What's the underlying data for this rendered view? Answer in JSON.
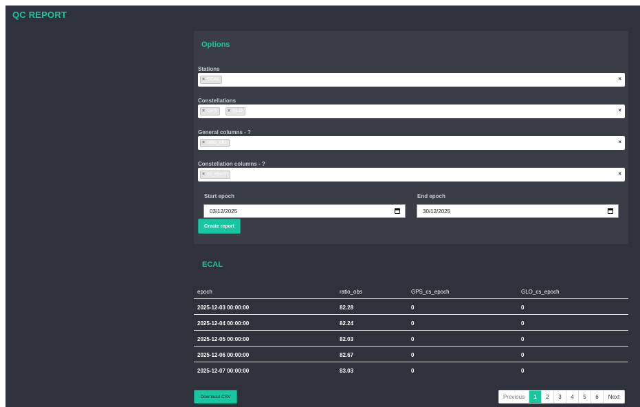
{
  "app": {
    "brand": "QC REPORT"
  },
  "options": {
    "title": "Options",
    "stations": {
      "label": "Stations",
      "tags": [
        "ECAL"
      ],
      "clear": "×"
    },
    "constellations": {
      "label": "Constellations",
      "tags": [
        "GPS",
        "GLO"
      ],
      "clear": "×"
    },
    "general_columns": {
      "label": "General columns - ?",
      "tags": [
        "ratio_obs"
      ],
      "clear": "×"
    },
    "constellation_columns": {
      "label": "Constellation columns - ?",
      "tags": [
        "cs_epoch"
      ],
      "clear": "×"
    },
    "start_epoch": {
      "label": "Start epoch",
      "value": "03/12/2025"
    },
    "end_epoch": {
      "label": "End epoch",
      "value": "30/12/2025"
    },
    "create_button": "Create report"
  },
  "report": {
    "title": "ECAL",
    "columns": [
      "epoch",
      "ratio_obs",
      "GPS_cs_epoch",
      "GLO_cs_epoch"
    ],
    "rows": [
      [
        "2025-12-03 00:00:00",
        "82.28",
        "0",
        "0"
      ],
      [
        "2025-12-04 00:00:00",
        "82.24",
        "0",
        "0"
      ],
      [
        "2025-12-05 00:00:00",
        "82.03",
        "0",
        "0"
      ],
      [
        "2025-12-06 00:00:00",
        "82.67",
        "0",
        "0"
      ],
      [
        "2025-12-07 00:00:00",
        "83.03",
        "0",
        "0"
      ]
    ],
    "download_button": "Download CSV"
  },
  "pagination": {
    "previous": "Previous",
    "pages": [
      "1",
      "2",
      "3",
      "4",
      "5",
      "6"
    ],
    "active_page": "1",
    "next": "Next"
  },
  "colors": {
    "accent": "#16c7a0",
    "background": "#2f323a",
    "panel": "#3a3d45"
  }
}
